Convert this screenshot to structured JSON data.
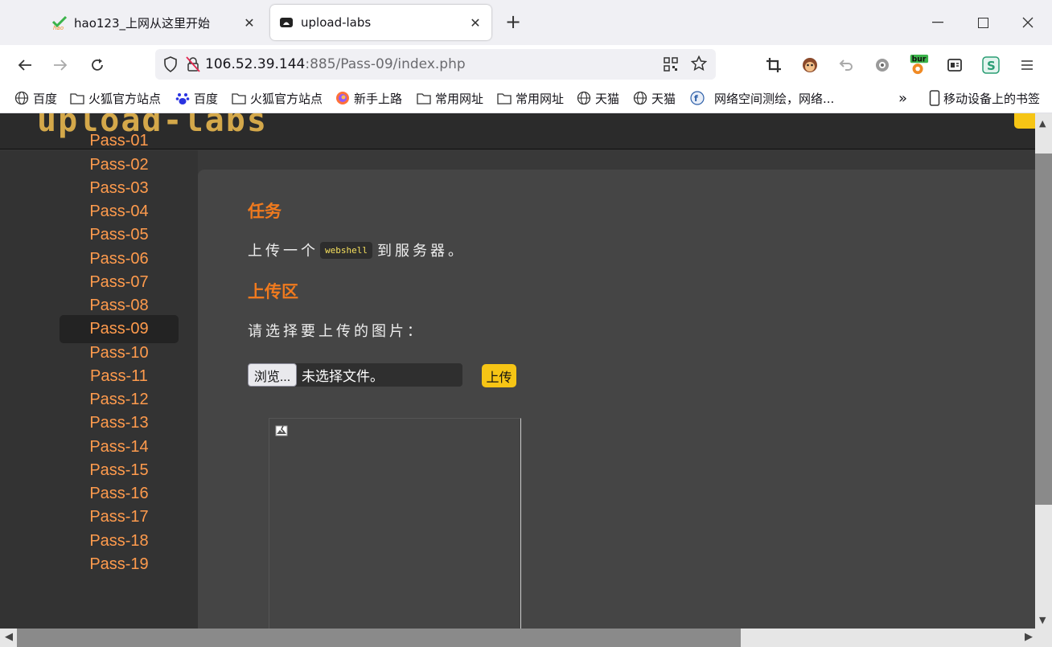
{
  "browser": {
    "tabs": [
      {
        "title": "hao123_上网从这里开始",
        "favicon": "hao123-icon"
      },
      {
        "title": "upload-labs",
        "favicon": "upload-labs-icon",
        "active": true
      }
    ],
    "new_tab": "+",
    "address": {
      "host": "106.52.39.144",
      "path": ":885/Pass-09/index.php"
    },
    "extensions": [
      "crop-icon",
      "monkey-icon",
      "undo-icon",
      "gear-icon",
      "burp-icon",
      "reader-icon",
      "s-icon",
      "menu-icon"
    ],
    "burp_badge": "bur",
    "bookmarks": [
      {
        "label": "百度",
        "icon": "globe-icon"
      },
      {
        "label": "火狐官方站点",
        "icon": "folder-icon"
      },
      {
        "label": "百度",
        "icon": "baidu-paw-icon"
      },
      {
        "label": "火狐官方站点",
        "icon": "folder-icon"
      },
      {
        "label": "新手上路",
        "icon": "firefox-icon"
      },
      {
        "label": "常用网址",
        "icon": "folder-icon"
      },
      {
        "label": "常用网址",
        "icon": "folder-icon"
      },
      {
        "label": "天猫",
        "icon": "globe-icon"
      },
      {
        "label": "天猫",
        "icon": "globe-icon"
      },
      {
        "label": "网络空间测绘，网络...",
        "icon": "fofa-icon"
      }
    ],
    "mobile_bookmarks": "移动设备上的书签",
    "overflow": "»"
  },
  "page": {
    "sidebar": [
      "Pass-01",
      "Pass-02",
      "Pass-03",
      "Pass-04",
      "Pass-05",
      "Pass-06",
      "Pass-07",
      "Pass-08",
      "Pass-09",
      "Pass-10",
      "Pass-11",
      "Pass-12",
      "Pass-13",
      "Pass-14",
      "Pass-15",
      "Pass-16",
      "Pass-17",
      "Pass-18",
      "Pass-19"
    ],
    "active_item": "Pass-09",
    "task": {
      "heading": "任务",
      "text_before": "上传一个",
      "code": "webshell",
      "text_after": "到服务器。"
    },
    "upload": {
      "heading": "上传区",
      "prompt": "请选择要上传的图片：",
      "browse_label": "浏览...",
      "file_status": "未选择文件。",
      "submit_label": "上传"
    }
  },
  "colors": {
    "accent_orange": "#f07a1e",
    "sidebar_link": "#ff9b4d",
    "button_yellow": "#f6c515",
    "content_bg": "#454545"
  }
}
